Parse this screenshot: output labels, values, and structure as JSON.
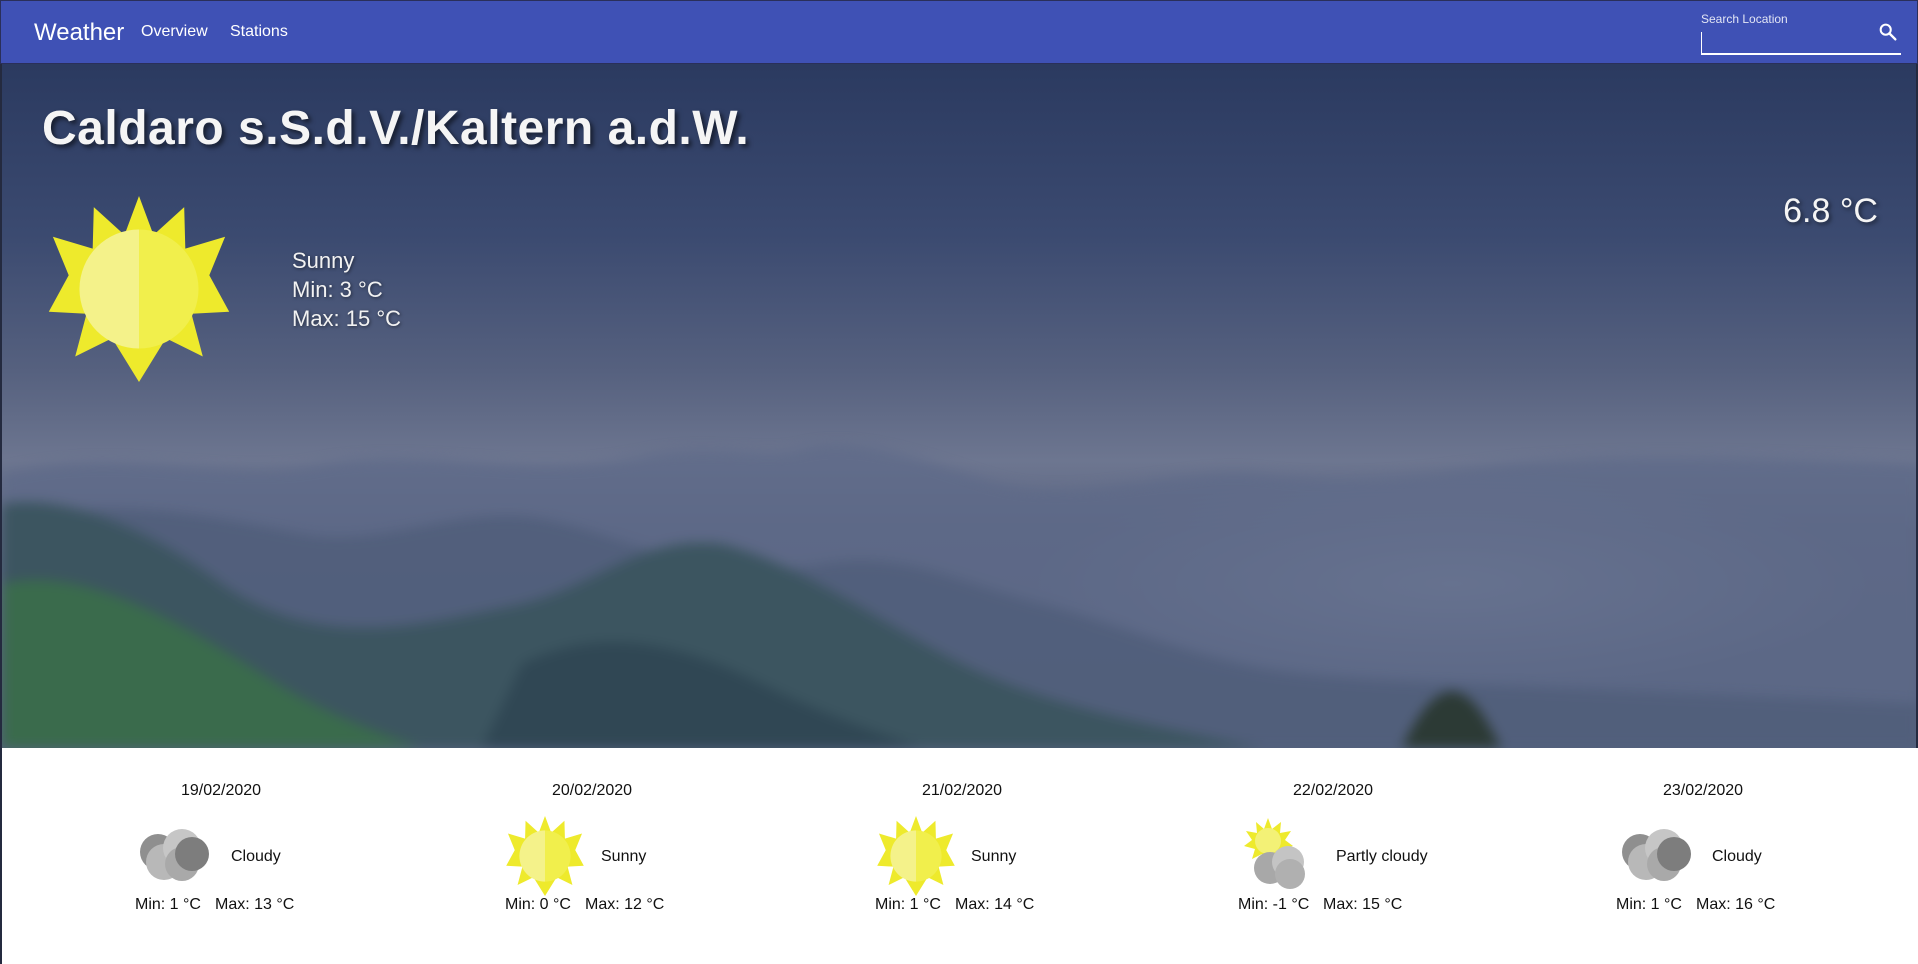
{
  "appbar": {
    "title": "Weather",
    "nav": [
      "Overview",
      "Stations"
    ],
    "search_label": "Search Location",
    "search_value": "",
    "color": "#3f51b5"
  },
  "current": {
    "location": "Caldaro s.S.d.V./Kaltern a.d.W.",
    "condition": "Sunny",
    "min": "Min: 3 °C",
    "max": "Max: 15 °C",
    "temperature": "6.8 °C",
    "icon": "sun-icon"
  },
  "forecast": [
    {
      "date": "19/02/2020",
      "condition": "Cloudy",
      "icon": "cloud-icon",
      "min": "Min: 1 °C",
      "max": "Max: 13 °C"
    },
    {
      "date": "20/02/2020",
      "condition": "Sunny",
      "icon": "sun-icon",
      "min": "Min: 0 °C",
      "max": "Max: 12 °C"
    },
    {
      "date": "21/02/2020",
      "condition": "Sunny",
      "icon": "sun-icon",
      "min": "Min: 1 °C",
      "max": "Max: 14 °C"
    },
    {
      "date": "22/02/2020",
      "condition": "Partly cloudy",
      "icon": "partly-cloudy-icon",
      "min": "Min: -1 °C",
      "max": "Max: 15 °C"
    },
    {
      "date": "23/02/2020",
      "condition": "Cloudy",
      "icon": "cloud-icon",
      "min": "Min: 1 °C",
      "max": "Max: 16 °C"
    }
  ]
}
